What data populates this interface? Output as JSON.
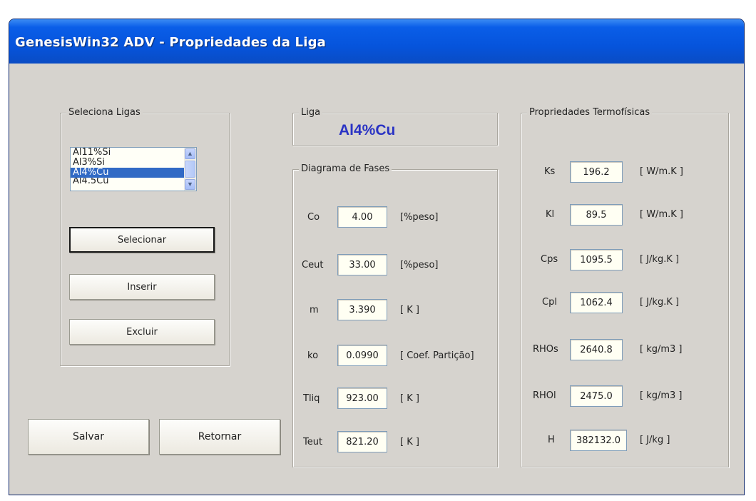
{
  "window": {
    "title": "GenesisWin32  ADV  - Propriedades da Liga"
  },
  "ligas": {
    "legend": "Seleciona Ligas",
    "items": [
      "Al11%Si",
      "Al3%Si",
      "Al4%Cu",
      "Al4,5Cu"
    ],
    "selected": "Al4%Cu",
    "buttons": {
      "selecionar": "Selecionar",
      "inserir": "Inserir",
      "excluir": "Excluir"
    }
  },
  "liga": {
    "legend": "Liga",
    "value": "Al4%Cu"
  },
  "diagrama": {
    "legend": "Diagrama de Fases",
    "rows": [
      {
        "label": "Co",
        "value": "4.00",
        "unit": "[%peso]"
      },
      {
        "label": "Ceut",
        "value": "33.00",
        "unit": "[%peso]"
      },
      {
        "label": "m",
        "value": "3.390",
        "unit": "[ K ]"
      },
      {
        "label": "ko",
        "value": "0.0990",
        "unit": "[ Coef. Partição]"
      },
      {
        "label": "Tliq",
        "value": "923.00",
        "unit": "[ K ]"
      },
      {
        "label": "Teut",
        "value": "821.20",
        "unit": "[ K ]"
      }
    ]
  },
  "propriedades": {
    "legend": "Propriedades Termofísicas",
    "rows": [
      {
        "label": "Ks",
        "value": "196.2",
        "unit": "[ W/m.K ]"
      },
      {
        "label": "Kl",
        "value": "89.5",
        "unit": "[ W/m.K ]"
      },
      {
        "label": "Cps",
        "value": "1095.5",
        "unit": "[ J/kg.K ]"
      },
      {
        "label": "Cpl",
        "value": "1062.4",
        "unit": "[ J/kg.K ]"
      },
      {
        "label": "RHOs",
        "value": "2640.8",
        "unit": "[ kg/m3 ]"
      },
      {
        "label": "RHOl",
        "value": "2475.0",
        "unit": "[ kg/m3 ]"
      },
      {
        "label": "H",
        "value": "382132.0",
        "unit": "[ J/kg ]"
      }
    ]
  },
  "actions": {
    "salvar": "Salvar",
    "retornar": "Retornar"
  }
}
